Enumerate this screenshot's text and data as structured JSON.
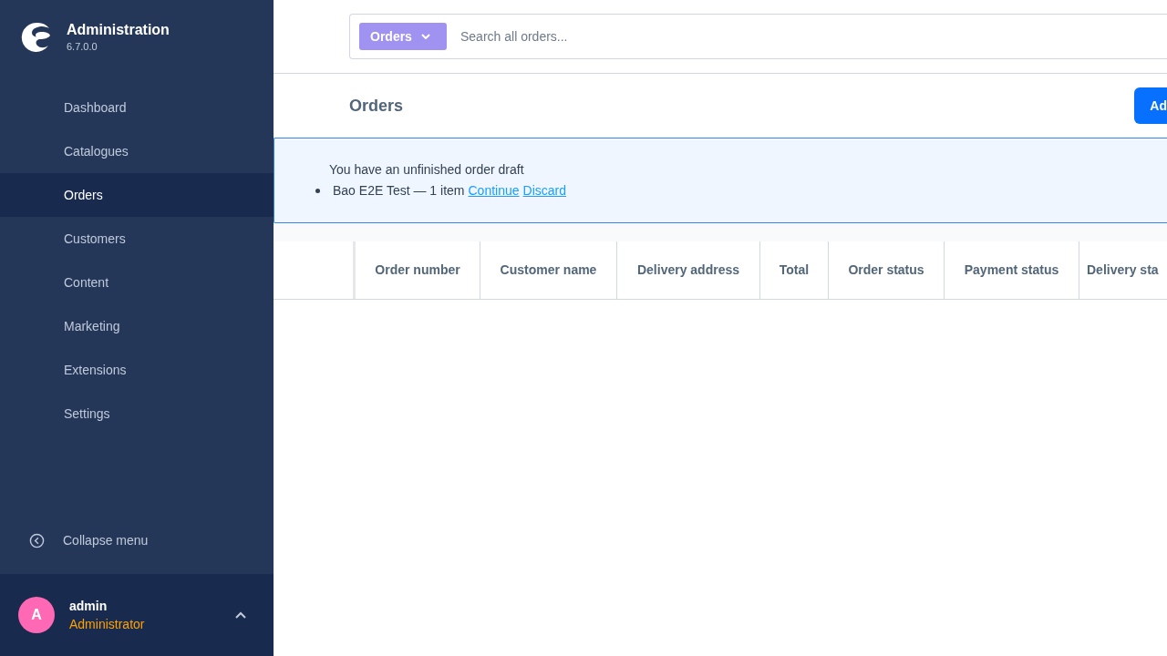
{
  "sidebar": {
    "title": "Administration",
    "version": "6.7.0.0",
    "items": [
      {
        "label": "Dashboard",
        "selected": false
      },
      {
        "label": "Catalogues",
        "selected": false
      },
      {
        "label": "Orders",
        "selected": true
      },
      {
        "label": "Customers",
        "selected": false
      },
      {
        "label": "Content",
        "selected": false
      },
      {
        "label": "Marketing",
        "selected": false
      },
      {
        "label": "Extensions",
        "selected": false
      },
      {
        "label": "Settings",
        "selected": false
      }
    ],
    "collapse": "Collapse menu",
    "user": {
      "initial": "A",
      "name": "admin",
      "role": "Administrator"
    }
  },
  "search": {
    "scope": "Orders",
    "placeholder": "Search all orders..."
  },
  "page": {
    "title": "Orders",
    "add_button": "Ad"
  },
  "notice": {
    "heading": "You have an unfinished order draft",
    "item": "Bao E2E Test — 1 item",
    "links": [
      "Continue",
      "Discard"
    ]
  },
  "table": {
    "columns": [
      "Order number",
      "Customer name",
      "Delivery address",
      "Total",
      "Order status",
      "Payment status",
      "Delivery sta"
    ]
  }
}
